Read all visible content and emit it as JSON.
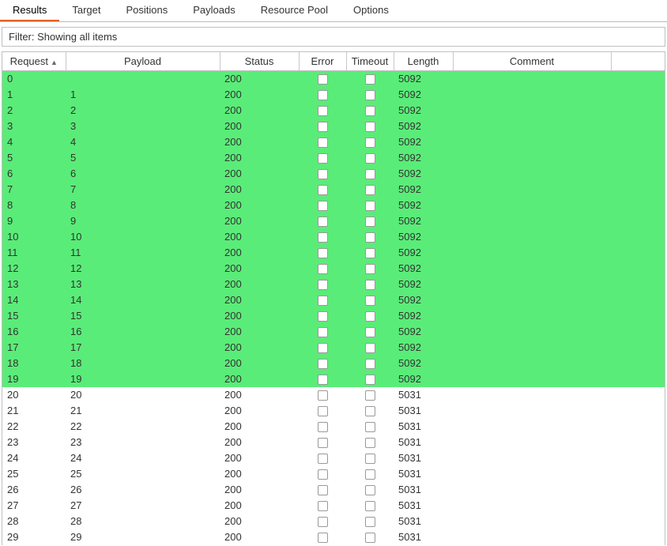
{
  "tabs": {
    "items": [
      {
        "label": "Results",
        "active": true
      },
      {
        "label": "Target",
        "active": false
      },
      {
        "label": "Positions",
        "active": false
      },
      {
        "label": "Payloads",
        "active": false
      },
      {
        "label": "Resource Pool",
        "active": false
      },
      {
        "label": "Options",
        "active": false
      }
    ]
  },
  "filter": {
    "text": "Filter: Showing all items"
  },
  "table": {
    "columns": {
      "request": "Request",
      "payload": "Payload",
      "status": "Status",
      "error": "Error",
      "timeout": "Timeout",
      "length": "Length",
      "comment": "Comment"
    },
    "sort": {
      "column": "request",
      "direction": "asc",
      "glyph": "▲"
    },
    "rows": [
      {
        "request": "0",
        "payload": "",
        "status": "200",
        "error": false,
        "timeout": false,
        "length": "5092",
        "comment": "",
        "highlight": true
      },
      {
        "request": "1",
        "payload": "1",
        "status": "200",
        "error": false,
        "timeout": false,
        "length": "5092",
        "comment": "",
        "highlight": true
      },
      {
        "request": "2",
        "payload": "2",
        "status": "200",
        "error": false,
        "timeout": false,
        "length": "5092",
        "comment": "",
        "highlight": true
      },
      {
        "request": "3",
        "payload": "3",
        "status": "200",
        "error": false,
        "timeout": false,
        "length": "5092",
        "comment": "",
        "highlight": true
      },
      {
        "request": "4",
        "payload": "4",
        "status": "200",
        "error": false,
        "timeout": false,
        "length": "5092",
        "comment": "",
        "highlight": true
      },
      {
        "request": "5",
        "payload": "5",
        "status": "200",
        "error": false,
        "timeout": false,
        "length": "5092",
        "comment": "",
        "highlight": true
      },
      {
        "request": "6",
        "payload": "6",
        "status": "200",
        "error": false,
        "timeout": false,
        "length": "5092",
        "comment": "",
        "highlight": true
      },
      {
        "request": "7",
        "payload": "7",
        "status": "200",
        "error": false,
        "timeout": false,
        "length": "5092",
        "comment": "",
        "highlight": true
      },
      {
        "request": "8",
        "payload": "8",
        "status": "200",
        "error": false,
        "timeout": false,
        "length": "5092",
        "comment": "",
        "highlight": true
      },
      {
        "request": "9",
        "payload": "9",
        "status": "200",
        "error": false,
        "timeout": false,
        "length": "5092",
        "comment": "",
        "highlight": true
      },
      {
        "request": "10",
        "payload": "10",
        "status": "200",
        "error": false,
        "timeout": false,
        "length": "5092",
        "comment": "",
        "highlight": true
      },
      {
        "request": "11",
        "payload": "11",
        "status": "200",
        "error": false,
        "timeout": false,
        "length": "5092",
        "comment": "",
        "highlight": true
      },
      {
        "request": "12",
        "payload": "12",
        "status": "200",
        "error": false,
        "timeout": false,
        "length": "5092",
        "comment": "",
        "highlight": true
      },
      {
        "request": "13",
        "payload": "13",
        "status": "200",
        "error": false,
        "timeout": false,
        "length": "5092",
        "comment": "",
        "highlight": true
      },
      {
        "request": "14",
        "payload": "14",
        "status": "200",
        "error": false,
        "timeout": false,
        "length": "5092",
        "comment": "",
        "highlight": true
      },
      {
        "request": "15",
        "payload": "15",
        "status": "200",
        "error": false,
        "timeout": false,
        "length": "5092",
        "comment": "",
        "highlight": true
      },
      {
        "request": "16",
        "payload": "16",
        "status": "200",
        "error": false,
        "timeout": false,
        "length": "5092",
        "comment": "",
        "highlight": true
      },
      {
        "request": "17",
        "payload": "17",
        "status": "200",
        "error": false,
        "timeout": false,
        "length": "5092",
        "comment": "",
        "highlight": true
      },
      {
        "request": "18",
        "payload": "18",
        "status": "200",
        "error": false,
        "timeout": false,
        "length": "5092",
        "comment": "",
        "highlight": true
      },
      {
        "request": "19",
        "payload": "19",
        "status": "200",
        "error": false,
        "timeout": false,
        "length": "5092",
        "comment": "",
        "highlight": true
      },
      {
        "request": "20",
        "payload": "20",
        "status": "200",
        "error": false,
        "timeout": false,
        "length": "5031",
        "comment": "",
        "highlight": false
      },
      {
        "request": "21",
        "payload": "21",
        "status": "200",
        "error": false,
        "timeout": false,
        "length": "5031",
        "comment": "",
        "highlight": false
      },
      {
        "request": "22",
        "payload": "22",
        "status": "200",
        "error": false,
        "timeout": false,
        "length": "5031",
        "comment": "",
        "highlight": false
      },
      {
        "request": "23",
        "payload": "23",
        "status": "200",
        "error": false,
        "timeout": false,
        "length": "5031",
        "comment": "",
        "highlight": false
      },
      {
        "request": "24",
        "payload": "24",
        "status": "200",
        "error": false,
        "timeout": false,
        "length": "5031",
        "comment": "",
        "highlight": false
      },
      {
        "request": "25",
        "payload": "25",
        "status": "200",
        "error": false,
        "timeout": false,
        "length": "5031",
        "comment": "",
        "highlight": false
      },
      {
        "request": "26",
        "payload": "26",
        "status": "200",
        "error": false,
        "timeout": false,
        "length": "5031",
        "comment": "",
        "highlight": false
      },
      {
        "request": "27",
        "payload": "27",
        "status": "200",
        "error": false,
        "timeout": false,
        "length": "5031",
        "comment": "",
        "highlight": false
      },
      {
        "request": "28",
        "payload": "28",
        "status": "200",
        "error": false,
        "timeout": false,
        "length": "5031",
        "comment": "",
        "highlight": false
      },
      {
        "request": "29",
        "payload": "29",
        "status": "200",
        "error": false,
        "timeout": false,
        "length": "5031",
        "comment": "",
        "highlight": false
      }
    ]
  }
}
